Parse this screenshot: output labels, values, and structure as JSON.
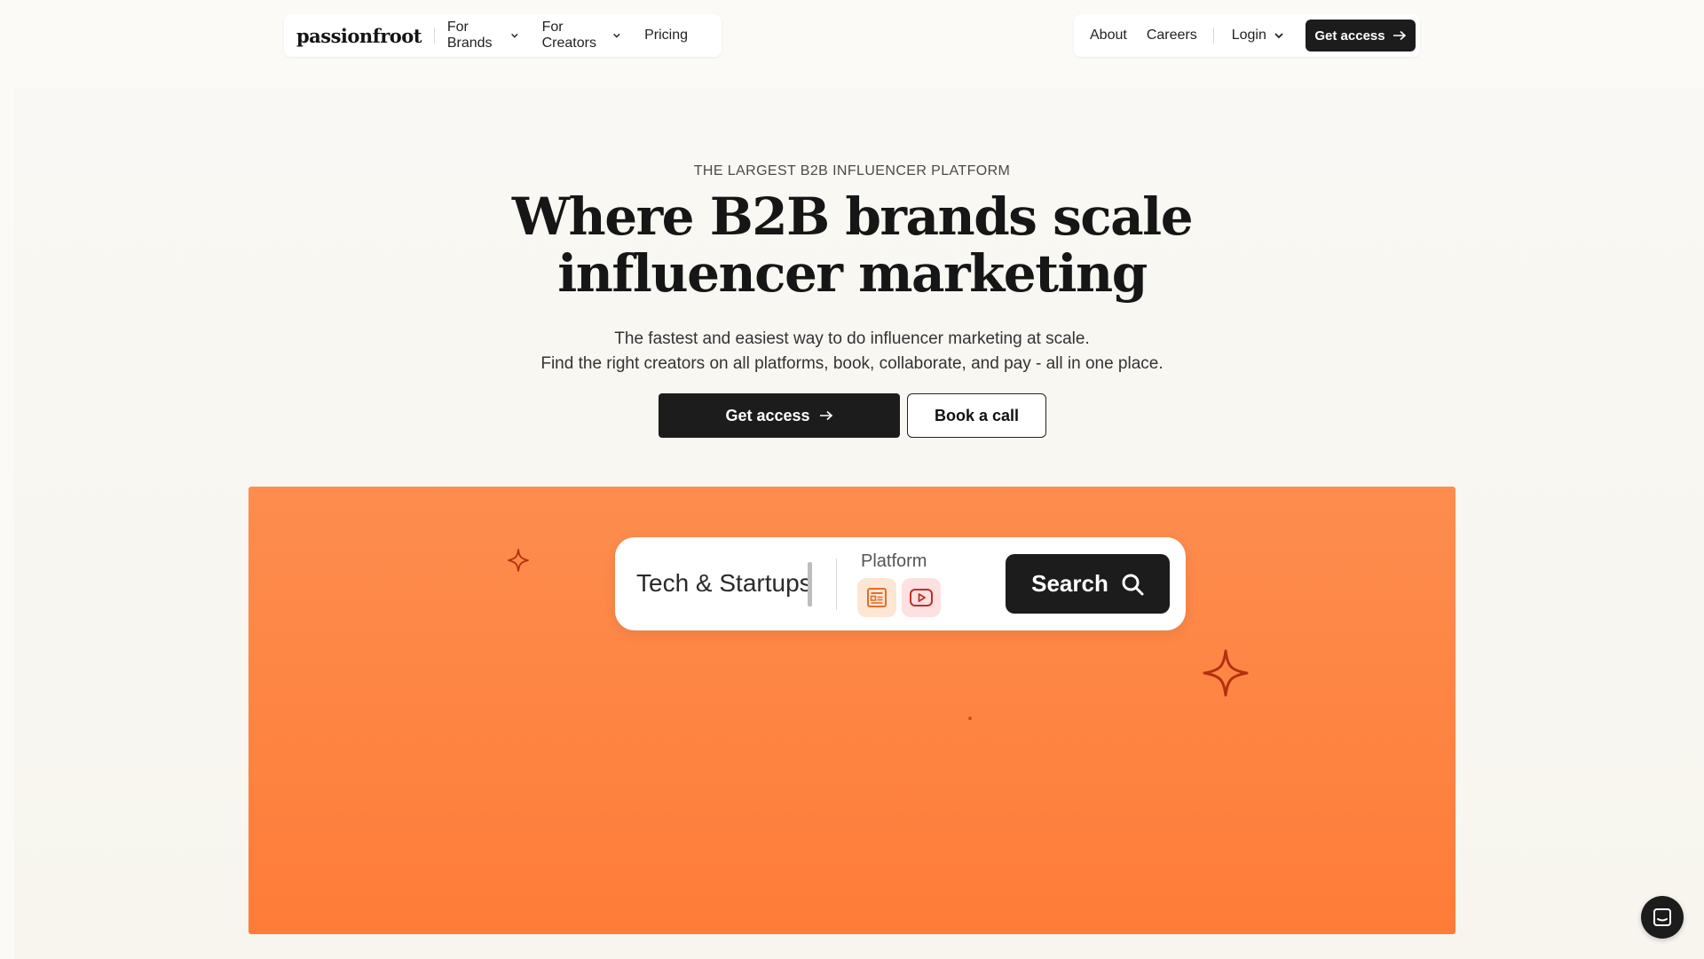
{
  "nav": {
    "logo": "passionfroot",
    "left_items": [
      {
        "label": "For Brands",
        "has_dropdown": true
      },
      {
        "label": "For Creators",
        "has_dropdown": true
      },
      {
        "label": "Pricing",
        "has_dropdown": false
      }
    ],
    "right_items": [
      {
        "label": "About"
      },
      {
        "label": "Careers"
      },
      {
        "label": "Login",
        "has_dropdown": true
      }
    ],
    "cta_label": "Get access"
  },
  "hero": {
    "eyebrow": "THE LARGEST B2B INFLUENCER PLATFORM",
    "headline_line1": "Where B2B brands scale",
    "headline_line2": "influencer marketing",
    "sub_line1": "The fastest and easiest way to do influencer marketing at scale.",
    "sub_line2": "Find the right creators on all platforms, book, collaborate, and pay - all in one place.",
    "primary_cta": "Get access",
    "secondary_cta": "Book a call"
  },
  "search_demo": {
    "query": "Tech & Startups",
    "platform_label": "Platform",
    "platform_icons": [
      "newsletter-icon",
      "youtube-icon"
    ],
    "button_label": "Search"
  },
  "colors": {
    "accent_orange": "#ff7c38",
    "dark": "#1c1c1c",
    "sparkle": "#b3300e"
  }
}
